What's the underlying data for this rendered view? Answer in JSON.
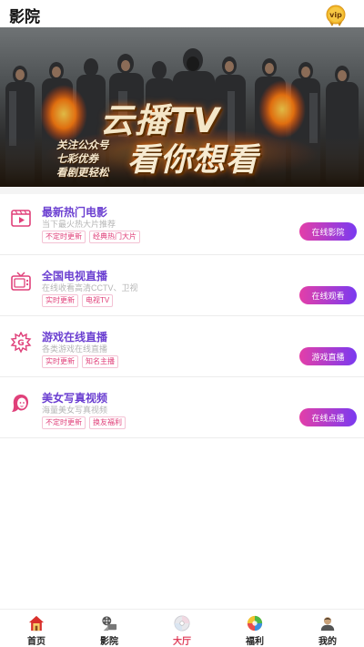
{
  "header": {
    "title": "影院",
    "vip_label": "vip"
  },
  "banner": {
    "main_text": "云播TV",
    "sub_text": "看你想看",
    "side_lines": [
      "关注公众号",
      "七彩优券",
      "看剧更轻松"
    ]
  },
  "items": [
    {
      "title": "最新热门电影",
      "subtitle": "当下最火热大片推荐",
      "tags": [
        "不定时更新",
        "经典热门大片"
      ],
      "button": "在线影院",
      "icon": "film-strip-icon"
    },
    {
      "title": "全国电视直播",
      "subtitle": "在线收看高清CCTV、卫视",
      "tags": [
        "实时更新",
        "电视TV"
      ],
      "button": "在线观看",
      "icon": "tv-icon"
    },
    {
      "title": "游戏在线直播",
      "subtitle": "各类游戏在线直播",
      "tags": [
        "实时更新",
        "知名主播"
      ],
      "button": "游戏直播",
      "icon": "game-g-icon"
    },
    {
      "title": "美女写真视频",
      "subtitle": "海量美女写真视频",
      "tags": [
        "不定时更新",
        "换友福利"
      ],
      "button": "在线点播",
      "icon": "girl-icon"
    }
  ],
  "tabbar": {
    "active": "大厅",
    "tabs": [
      {
        "label": "首页",
        "icon": "home-icon"
      },
      {
        "label": "影院",
        "icon": "film-reel-icon"
      },
      {
        "label": "大厅",
        "icon": "disc-icon"
      },
      {
        "label": "福利",
        "icon": "gift-ball-icon"
      },
      {
        "label": "我的",
        "icon": "user-icon"
      }
    ]
  },
  "colors": {
    "accent_purple": "#6b3fd1",
    "accent_pink": "#e0407a",
    "button_gradient_start": "#e33fa8",
    "button_gradient_end": "#7a3af0",
    "active_tab": "#e0405c"
  }
}
